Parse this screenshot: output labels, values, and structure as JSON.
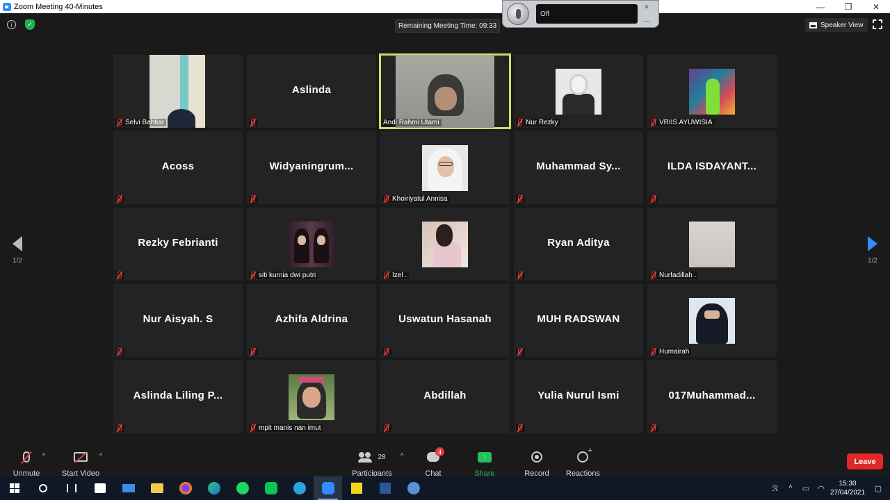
{
  "window": {
    "title": "Zoom Meeting 40-Minutes",
    "min": "—",
    "max": "❐",
    "close": "✕"
  },
  "meeting": {
    "remaining_time": "Remaining Meeting Time: 09:33",
    "view_mode": "Speaker View",
    "mic_widget_status": "Off"
  },
  "participants": [
    {
      "name": "Selvi Bahtiar",
      "display": "",
      "has_video": true
    },
    {
      "name": "",
      "display": "Aslinda",
      "has_video": false
    },
    {
      "name": "Andi Rahmi Utami",
      "display": "",
      "has_video": true,
      "active_speaker": true
    },
    {
      "name": "Nur Rezky",
      "display": "",
      "has_video": true
    },
    {
      "name": "VRIIS AYUWISIA",
      "display": "",
      "has_video": true
    },
    {
      "name": "",
      "display": "Acoss",
      "has_video": false
    },
    {
      "name": "",
      "display": "Widyaningrum...",
      "has_video": false
    },
    {
      "name": "Khoiriyatul Annisa",
      "display": "",
      "has_video": true
    },
    {
      "name": "",
      "display": "Muhammad  Sy...",
      "has_video": false
    },
    {
      "name": "",
      "display": "ILDA  ISDAYANT...",
      "has_video": false
    },
    {
      "name": "",
      "display": "Rezky Febrianti",
      "has_video": false
    },
    {
      "name": "siti kurnia dwi putri",
      "display": "",
      "has_video": true
    },
    {
      "name": "Izel .",
      "display": "",
      "has_video": true
    },
    {
      "name": "",
      "display": "Ryan Aditya",
      "has_video": false
    },
    {
      "name": "Nurfadillah .",
      "display": "",
      "has_video": true
    },
    {
      "name": "",
      "display": "Nur Aisyah. S",
      "has_video": false
    },
    {
      "name": "",
      "display": "Azhifa Aldrina",
      "has_video": false
    },
    {
      "name": "",
      "display": "Uswatun Hasanah",
      "has_video": false
    },
    {
      "name": "",
      "display": "MUH RADSWAN",
      "has_video": false
    },
    {
      "name": "Humairah",
      "display": "",
      "has_video": true
    },
    {
      "name": "",
      "display": "Aslinda  Liling  P...",
      "has_video": false
    },
    {
      "name": "mpit manis nan imut",
      "display": "",
      "has_video": true
    },
    {
      "name": "",
      "display": "Abdillah",
      "has_video": false
    },
    {
      "name": "",
      "display": "Yulia Nurul Ismi",
      "has_video": false
    },
    {
      "name": "",
      "display": "017Muhammad...",
      "has_video": false
    }
  ],
  "pagination": {
    "left": "1/2",
    "right": "1/2"
  },
  "toolbar": {
    "unmute": "Unmute",
    "start_video": "Start Video",
    "participants": "Participants",
    "participants_count": "28",
    "chat": "Chat",
    "chat_badge": "4",
    "share_screen": "Share Screen",
    "record": "Record",
    "reactions": "Reactions",
    "leave": "Leave",
    "caret": "^"
  },
  "taskbar": {
    "time": "15:30",
    "date": "27/04/2021"
  },
  "colors": {
    "accent": "#2d8cff",
    "share_green": "#23c15d",
    "leave_red": "#e02828",
    "active_outline": "#c8e06b"
  }
}
